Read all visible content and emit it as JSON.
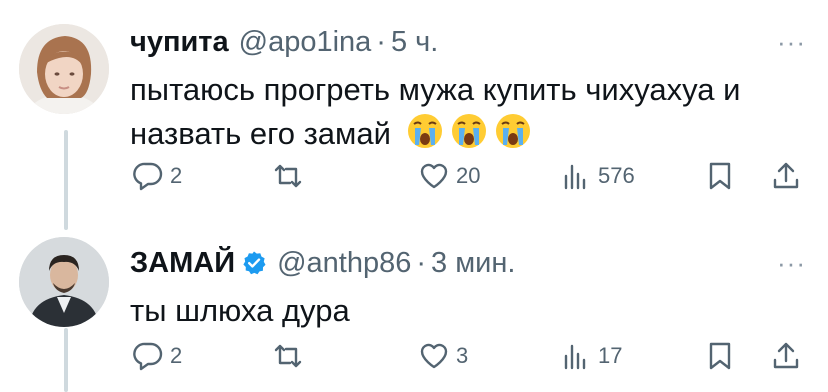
{
  "tweets": [
    {
      "name": "чупита",
      "handle": "@apo1ina",
      "separator": "·",
      "time": "5 ч.",
      "more": "···",
      "text": "пытаюсь прогреть мужа купить чихуахуа и назвать его замай",
      "emojis": [
        "crying-face",
        "crying-face",
        "crying-face"
      ],
      "reply_count": "2",
      "retweet_count": "",
      "like_count": "20",
      "view_count": "576",
      "verified": false
    },
    {
      "name": "ЗАМАЙ",
      "handle": "@anthp86",
      "separator": "·",
      "time": "3 мин.",
      "more": "···",
      "text": "ты шлюха дура",
      "reply_count": "2",
      "retweet_count": "",
      "like_count": "3",
      "view_count": "17",
      "verified": true
    }
  ],
  "colors": {
    "text": "#0f1419",
    "secondary": "#536471",
    "verified": "#1d9bf0",
    "thread_line": "#cfd9de"
  }
}
